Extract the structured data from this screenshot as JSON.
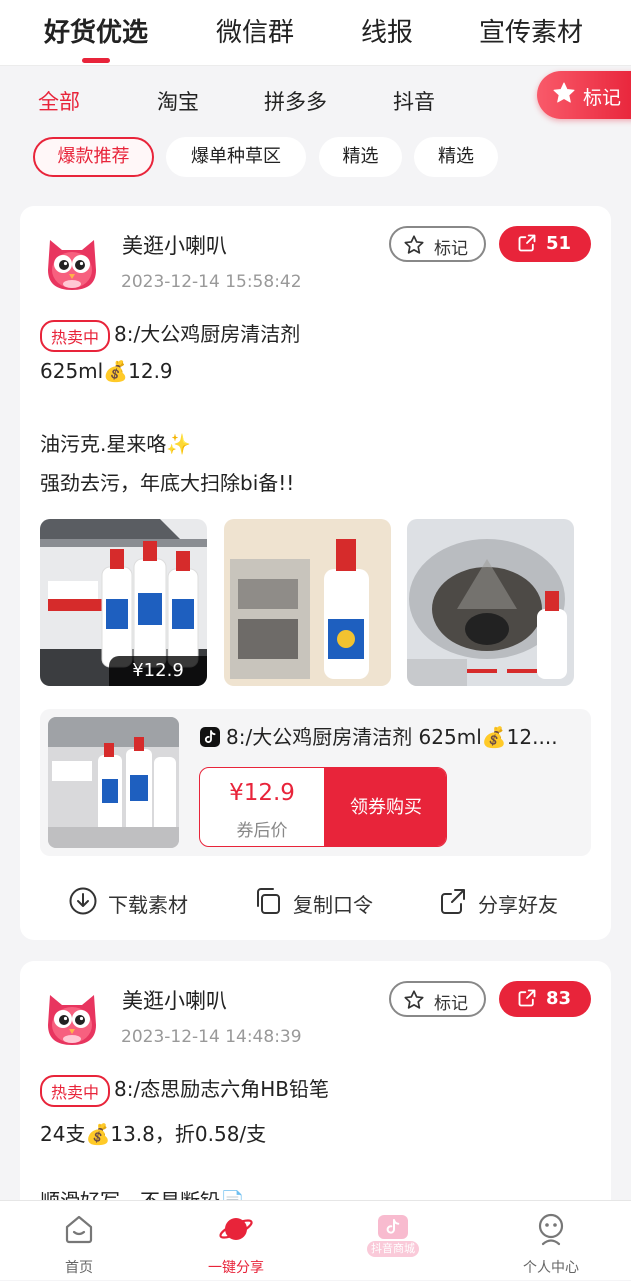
{
  "top_tabs": [
    "好货优选",
    "微信群",
    "线报",
    "宣传素材"
  ],
  "platforms": [
    "全部",
    "淘宝",
    "拼多多",
    "抖音"
  ],
  "mark_tab_label": "标记",
  "categories": [
    "爆款推荐",
    "爆单种草区",
    "精选",
    "精选"
  ],
  "posts": [
    {
      "author": "美逛小喇叭",
      "time": "2023-12-14 15:58:42",
      "mark_label": "标记",
      "share_count": "51",
      "hot_label": "热卖中",
      "line1": "8:/大公鸡厨房清洁剂",
      "line2": "625ml💰12.9",
      "line3": "油污克.星来咯✨",
      "line4": "强劲去污，年底大扫除bi备!!",
      "thumb_price": "¥12.9",
      "product_title": "8:/大公鸡厨房清洁剂 625ml💰12....",
      "coupon_price": "¥12.9",
      "coupon_label": "券后价",
      "buy_label": "领券购买",
      "actions": [
        "下载素材",
        "复制口令",
        "分享好友"
      ]
    },
    {
      "author": "美逛小喇叭",
      "time": "2023-12-14 14:48:39",
      "mark_label": "标记",
      "share_count": "83",
      "hot_label": "热卖中",
      "line1": "8:/态思励志六角HB铅笔",
      "line2": "24支💰13.8，折0.58/支",
      "line3": "顺滑好写，不易断铅📄"
    }
  ],
  "bottom_nav": [
    "首页",
    "一键分享",
    "抖音商城",
    "个人中心"
  ],
  "colors": {
    "accent": "#e8243a",
    "background": "#f4f4f6"
  }
}
